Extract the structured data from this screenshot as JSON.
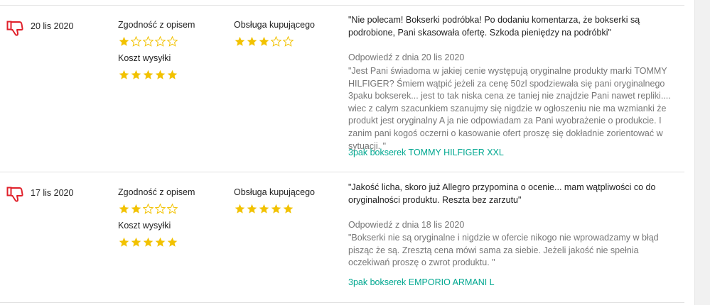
{
  "colors": {
    "accent": "#00a790",
    "star": "#f2c200",
    "thumb": "#e0212b",
    "muted": "#767676"
  },
  "reviews": [
    {
      "icon": "thumbs-down-icon",
      "date": "20 lis 2020",
      "rating_description_label": "Zgodność z opisem",
      "rating_description": 1,
      "rating_service_label": "Obsługa kupującego",
      "rating_service": 3,
      "rating_shipping_label": "Koszt wysyłki",
      "rating_shipping": 5,
      "comment": "\"Nie polecam! Bokserki podróbka! Po dodaniu komentarza, że bokserki są podrobione, Pani skasowała ofertę. Szkoda pieniędzy na podróbki\"",
      "reply_date": "Odpowiedź z dnia 20 lis 2020",
      "reply": "\"Jest Pani świadoma w jakiej cenie występują oryginalne produkty marki TOMMY HILFIGER? Śmiem wątpić jeżeli za cenę 50zl spodziewała się pani oryginalnego 3paku bokserek... jest to tak niska cena ze taniej nie znajdzie Pani nawet repliki.... wiec z calym szacunkiem szanujmy się nigdzie w ogłoszeniu nie ma wzmianki że produkt jest oryginalny A ja nie odpowiadam za Pani wyobrażenie o produkcie. I zanim pani kogoś oczerni o kasowanie ofert proszę się dokładnie zorientować w sytuacji. \"",
      "product": "3pak bokserek TOMMY HILFIGER XXL"
    },
    {
      "icon": "thumbs-down-icon",
      "date": "17 lis 2020",
      "rating_description_label": "Zgodność z opisem",
      "rating_description": 2,
      "rating_service_label": "Obsługa kupującego",
      "rating_service": 5,
      "rating_shipping_label": "Koszt wysyłki",
      "rating_shipping": 5,
      "comment": "\"Jakość licha, skoro już Allegro przypomina o ocenie... mam wątpliwości co do oryginalności produktu. Reszta bez zarzutu\"",
      "reply_date": "Odpowiedź z dnia 18 lis 2020",
      "reply": "\"Bokserki nie są oryginalne i nigdzie w ofercie nikogo nie wprowadzamy w błąd pisząc że są. Zresztą cena mówi sama za siebie. Jeżeli jakość nie spełnia oczekiwań proszę o zwrot produktu. \"",
      "product": "3pak bokserek EMPORIO ARMANI L"
    }
  ]
}
